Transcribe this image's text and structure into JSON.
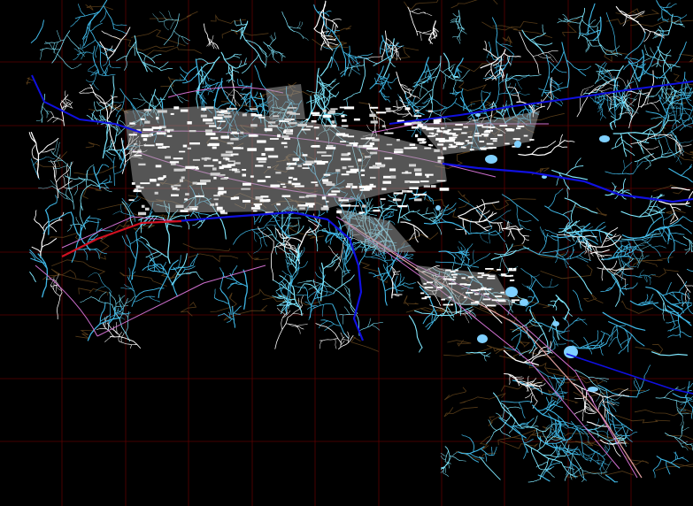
{
  "canvas": {
    "background": "#000000"
  },
  "colors": {
    "grid": "#5a0000",
    "streams_light": "#3fb7e6",
    "streams_bright": "#7fe8ff",
    "streams_white": "#ffffff",
    "contours": "#6b4a1e",
    "river_main": "#1010e0",
    "river_accent": "#d01020",
    "roads": "#d070d0",
    "urban_fill": "#9a9a9a",
    "urban_blocks": "#ffffff",
    "lakes": "#7fd0ff",
    "highway": "#e0a0a0"
  },
  "map": {
    "kind": "CAD topographic drainage map",
    "layers": [
      "grid",
      "contours",
      "streams",
      "rivers",
      "roads",
      "urban-area",
      "lakes"
    ]
  }
}
